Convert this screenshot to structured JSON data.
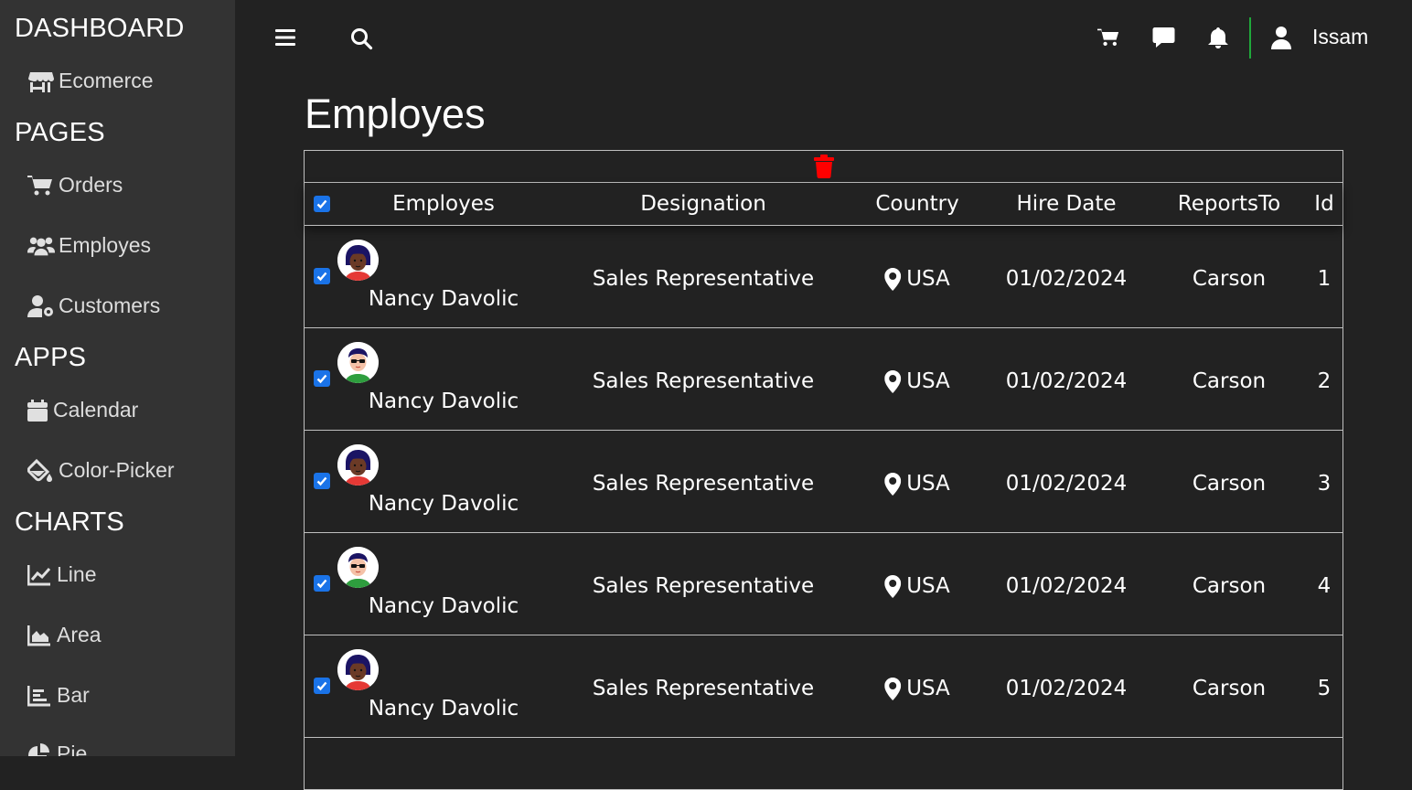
{
  "sidebar": {
    "sections": [
      {
        "title": "DASHBOARD",
        "items": [
          {
            "label": "Ecomerce",
            "icon": "shop-icon"
          }
        ]
      },
      {
        "title": "PAGES",
        "items": [
          {
            "label": "Orders",
            "icon": "cart-icon"
          },
          {
            "label": "Employes",
            "icon": "users-icon"
          },
          {
            "label": "Customers",
            "icon": "user-gear-icon"
          }
        ]
      },
      {
        "title": "APPS",
        "items": [
          {
            "label": "Calendar",
            "icon": "calendar-icon"
          },
          {
            "label": "Color-Picker",
            "icon": "paint-bucket-icon"
          }
        ]
      },
      {
        "title": "CHARTS",
        "items": [
          {
            "label": "Line",
            "icon": "line-chart-icon"
          },
          {
            "label": "Area",
            "icon": "area-chart-icon"
          },
          {
            "label": "Bar",
            "icon": "bar-chart-icon"
          },
          {
            "label": "Pie",
            "icon": "pie-chart-icon"
          }
        ]
      }
    ]
  },
  "topbar": {
    "icons": [
      "menu-icon",
      "search-icon",
      "cart-icon",
      "chat-icon",
      "bell-icon",
      "user-icon"
    ],
    "username": "Issam",
    "divider_color": "#1fa83a"
  },
  "page": {
    "title": "Employes"
  },
  "grid": {
    "columns": [
      "Employes",
      "Designation",
      "Country",
      "Hire Date",
      "ReportsTo",
      "Id"
    ],
    "rows": [
      {
        "name": "Nancy Davolic",
        "designation": "Sales Representative",
        "country": "USA",
        "hire_date": "01/02/2024",
        "reports_to": "Carson",
        "id": "1",
        "avatar": "avatar-female",
        "checked": true
      },
      {
        "name": "Nancy Davolic",
        "designation": "Sales Representative",
        "country": "USA",
        "hire_date": "01/02/2024",
        "reports_to": "Carson",
        "id": "2",
        "avatar": "avatar-male",
        "checked": true
      },
      {
        "name": "Nancy Davolic",
        "designation": "Sales Representative",
        "country": "USA",
        "hire_date": "01/02/2024",
        "reports_to": "Carson",
        "id": "3",
        "avatar": "avatar-female",
        "checked": true
      },
      {
        "name": "Nancy Davolic",
        "designation": "Sales Representative",
        "country": "USA",
        "hire_date": "01/02/2024",
        "reports_to": "Carson",
        "id": "4",
        "avatar": "avatar-male",
        "checked": true
      },
      {
        "name": "Nancy Davolic",
        "designation": "Sales Representative",
        "country": "USA",
        "hire_date": "01/02/2024",
        "reports_to": "Carson",
        "id": "5",
        "avatar": "avatar-female",
        "checked": true
      }
    ]
  },
  "colors": {
    "accent": "#1a73e8",
    "delete": "#ff0000",
    "background": "#222222",
    "sidebar": "#333333"
  }
}
